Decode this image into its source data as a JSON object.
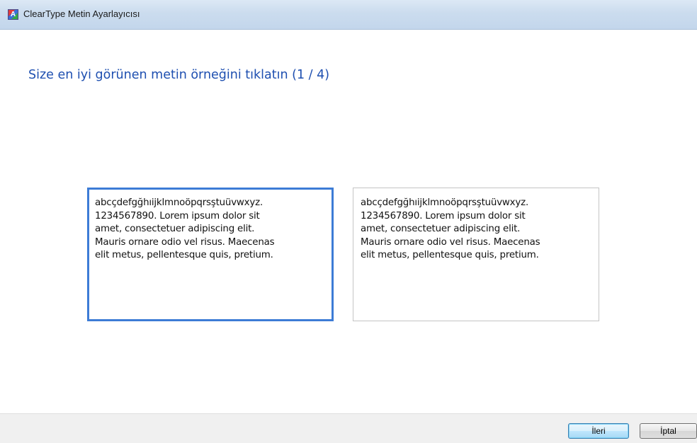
{
  "window": {
    "title": "ClearType Metin Ayarlayıcısı",
    "icon": "cleartype-app-icon",
    "icon_letter": "A"
  },
  "main": {
    "heading": "Size en iyi görünen metin örneğini tıklatın (1 / 4)",
    "samples": [
      {
        "selected": true,
        "lines": [
          "abcçdefgğhıijklmnoöpqrsştuüvwxyz.",
          "1234567890. Lorem ipsum dolor sit",
          "amet, consectetuer adipiscing elit.",
          "Mauris ornare odio vel risus. Maecenas",
          "elit metus, pellentesque quis, pretium."
        ]
      },
      {
        "selected": false,
        "lines": [
          "abcçdefgğhıijklmnoöpqrsştuüvwxyz.",
          "1234567890. Lorem ipsum dolor sit",
          "amet, consectetuer adipiscing elit.",
          "Mauris ornare odio vel risus. Maecenas",
          "elit metus, pellentesque quis, pretium."
        ]
      }
    ]
  },
  "footer": {
    "next_label": "İleri",
    "cancel_label": "İptal"
  },
  "colors": {
    "heading": "#1e4fb0",
    "selected_border": "#3d7cd6",
    "unselected_border": "#c4c4c4",
    "footer_background": "#f0f0f0"
  }
}
